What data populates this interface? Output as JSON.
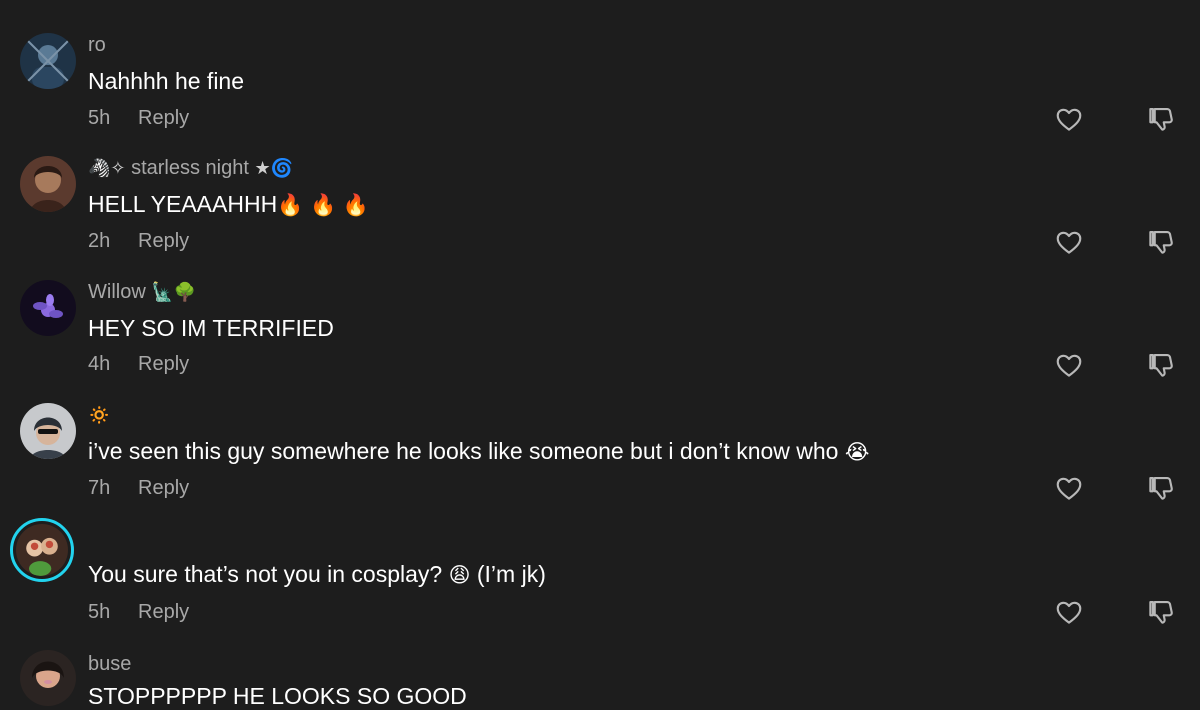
{
  "comments": [
    {
      "username": "ro",
      "text": "Nahhhh he fine",
      "time": "5h",
      "reply_label": "Reply",
      "avatar_colors": [
        "#1f3346",
        "#5a7a95"
      ]
    },
    {
      "username_prefix": "🦓✧",
      "username": "starless night",
      "username_suffix": "★🌀",
      "text": "HELL YEAAAHHH",
      "text_emoji": "🔥 🔥 🔥",
      "time": "2h",
      "reply_label": "Reply",
      "avatar_colors": [
        "#5b3a2e",
        "#a77a5c"
      ]
    },
    {
      "username": "Willow",
      "username_suffix": "🗽🌳",
      "text": "HEY SO IM TERRIFIED",
      "time": "4h",
      "reply_label": "Reply",
      "avatar_colors": [
        "#120c1e",
        "#8b6adf"
      ]
    },
    {
      "username": "🔅",
      "text": "i’ve seen this guy somewhere he looks like someone but i don’t know who",
      "text_emoji": "😭",
      "time": "7h",
      "reply_label": "Reply",
      "avatar_colors": [
        "#c7c9cc",
        "#2a2f36"
      ]
    },
    {
      "username": "",
      "text": "You sure that’s not you in cosplay?",
      "text_emoji": "😩",
      "text_suffix": "(I’m jk)",
      "time": "5h",
      "reply_label": "Reply",
      "avatar_colors": [
        "#3e2a22",
        "#c24b3a"
      ],
      "ring_color": "#22d3ee"
    },
    {
      "username": "buse",
      "text": "STOPPPPPP HE LOOKS SO GOOD",
      "avatar_colors": [
        "#2b2422",
        "#d38fa1"
      ]
    }
  ]
}
